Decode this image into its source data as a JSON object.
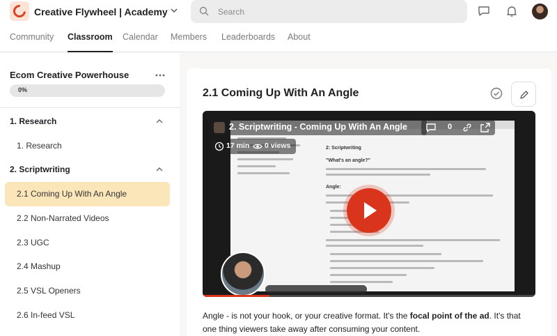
{
  "app": {
    "brand": "Creative Flywheel | Academy",
    "search_placeholder": "Search"
  },
  "nav": {
    "tabs": [
      "Community",
      "Classroom",
      "Calendar",
      "Members",
      "Leaderboards",
      "About"
    ],
    "active": "Classroom"
  },
  "sidebar": {
    "course_title": "Ecom Creative Powerhouse",
    "progress_label": "0%",
    "progress_value": 0,
    "modules": [
      {
        "title": "1. Research",
        "lessons": [
          "1. Research"
        ]
      },
      {
        "title": "2. Scriptwriting",
        "lessons": [
          "2.1 Coming Up With An Angle",
          "2.2 Non-Narrated Videos",
          "2.3 UGC",
          "2.4 Mashup",
          "2.5 VSL Openers",
          "2.6 In-feed VSL"
        ]
      }
    ],
    "active_lesson": "2.1 Coming Up With An Angle"
  },
  "main": {
    "lesson_title": "2.1 Coming Up With An Angle",
    "video": {
      "title": "2. Scriptwriting - Coming Up With An Angle",
      "comments": "0",
      "duration": "17 min",
      "views": "0 views",
      "doc_heading": "2: Scriptwriting",
      "doc_subheading": "\"What's an angle?\"",
      "doc_section": "Angle:",
      "progress": 0.2
    },
    "description": {
      "before": "Angle - is not your hook, or your creative format. It's the ",
      "bold": "focal point of the ad",
      "after": ". It's that one thing viewers take away after consuming your content."
    }
  },
  "colors": {
    "accent": "#d9431f",
    "active_lesson_bg": "#fbe6b9",
    "play_button": "#d9351d"
  }
}
